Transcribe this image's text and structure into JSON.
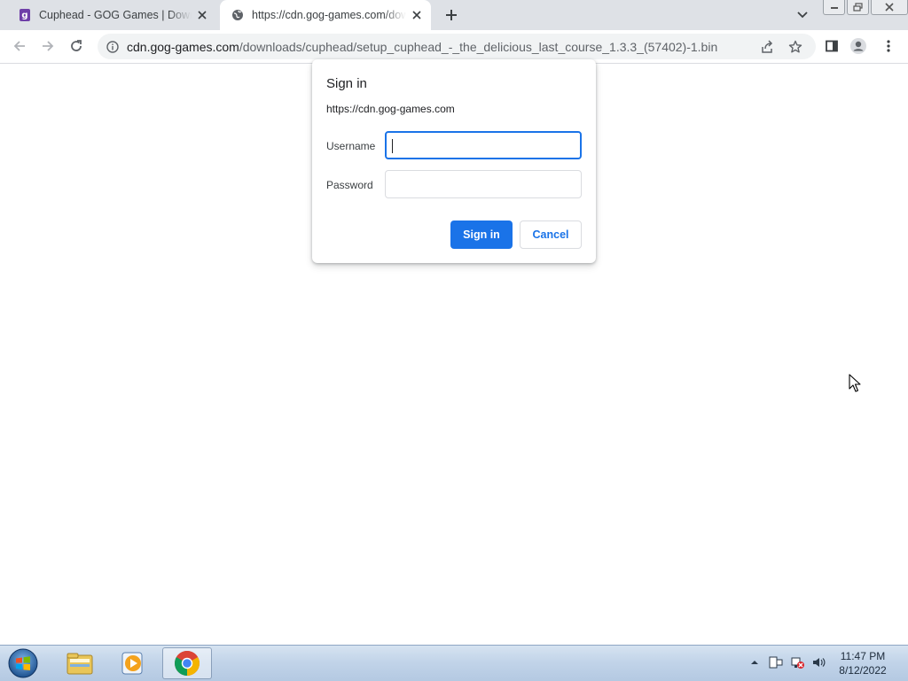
{
  "browser": {
    "tabs": [
      {
        "title": "Cuphead - GOG Games | Download",
        "favicon": "gog-icon",
        "active": false
      },
      {
        "title": "https://cdn.gog-games.com/downloads/cuphead",
        "favicon": "globe-icon",
        "active": true
      }
    ],
    "address": {
      "domain": "cdn.gog-games.com",
      "path": "/downloads/cuphead/setup_cuphead_-_the_delicious_last_course_1.3.3_(57402)-1.bin"
    }
  },
  "dialog": {
    "title": "Sign in",
    "origin": "https://cdn.gog-games.com",
    "username_label": "Username",
    "username_value": "",
    "password_label": "Password",
    "password_value": "",
    "signin_label": "Sign in",
    "cancel_label": "Cancel"
  },
  "taskbar": {
    "apps": [
      "explorer-icon",
      "media-player-icon",
      "chrome-icon"
    ],
    "active_app": "chrome-icon",
    "time": "11:47 PM",
    "date": "8/12/2022"
  },
  "colors": {
    "accent": "#1a73e8",
    "tabstrip": "#dee1e6",
    "omnibox": "#f1f3f4"
  }
}
